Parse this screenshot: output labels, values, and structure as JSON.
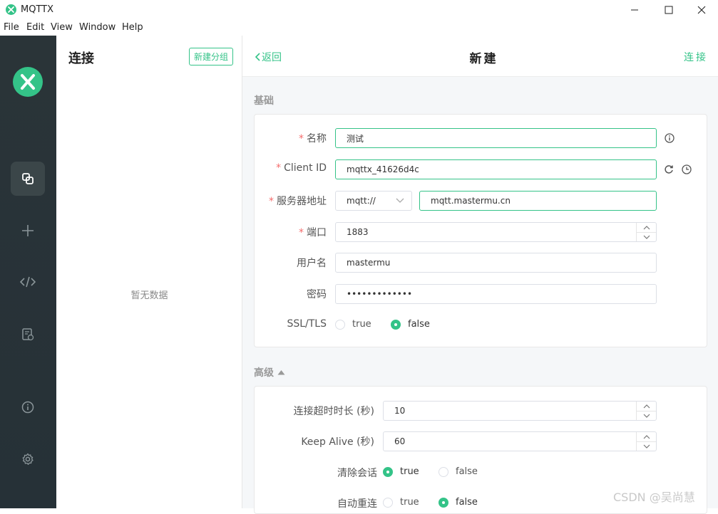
{
  "app": {
    "title": "MQTTX"
  },
  "menu": [
    "File",
    "Edit",
    "View",
    "Window",
    "Help"
  ],
  "connections": {
    "title": "连接",
    "new_group_label": "新建分组",
    "empty_text": "暂无数据"
  },
  "topbar": {
    "back_label": "返回",
    "title": "新建",
    "connect_label": "连接"
  },
  "basic": {
    "section_title": "基础",
    "name": {
      "label": "名称",
      "value": "测试"
    },
    "client_id": {
      "label": "Client ID",
      "value": "mqttx_41626d4c"
    },
    "server": {
      "label": "服务器地址",
      "protocol": "mqtt://",
      "host": "mqtt.mastermu.cn"
    },
    "port": {
      "label": "端口",
      "value": "1883"
    },
    "username": {
      "label": "用户名",
      "value": "mastermu"
    },
    "password": {
      "label": "密码",
      "value": "•••••••••••••"
    },
    "ssl": {
      "label": "SSL/TLS",
      "true_label": "true",
      "false_label": "false",
      "selected": "false"
    }
  },
  "advanced": {
    "section_title": "高级",
    "timeout": {
      "label": "连接超时时长 (秒)",
      "value": "10"
    },
    "keepalive": {
      "label": "Keep Alive (秒)",
      "value": "60"
    },
    "clean_session": {
      "label": "清除会话",
      "true_label": "true",
      "false_label": "false",
      "selected": "true"
    },
    "auto_reconnect": {
      "label": "自动重连",
      "true_label": "true",
      "false_label": "false",
      "selected": "false"
    }
  },
  "watermark": "CSDN @吴尚慧",
  "colors": {
    "accent": "#34c388",
    "sidebar": "#283338",
    "required": "#f56c6c"
  }
}
